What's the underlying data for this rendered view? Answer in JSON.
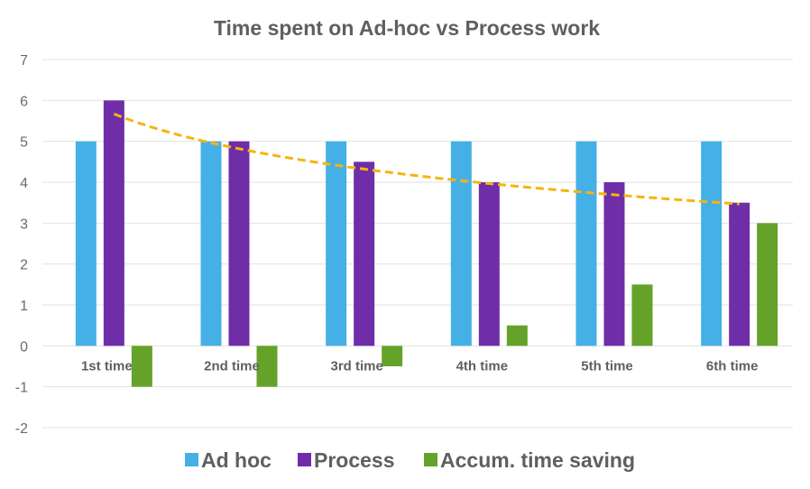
{
  "chart_data": {
    "type": "bar",
    "title": "Time spent on Ad-hoc vs Process work",
    "xlabel": "",
    "ylabel": "",
    "categories": [
      "1st time",
      "2nd time",
      "3rd time",
      "4th time",
      "5th time",
      "6th time"
    ],
    "series": [
      {
        "name": "Ad hoc",
        "color": "#45b0e5",
        "values": [
          5,
          5,
          5,
          5,
          5,
          5
        ]
      },
      {
        "name": "Process",
        "color": "#6f2da8",
        "values": [
          6,
          5,
          4.5,
          4,
          4,
          3.5
        ]
      },
      {
        "name": "Accum. time saving",
        "color": "#65a22a",
        "values": [
          -1,
          -1,
          -0.5,
          0.5,
          1.5,
          3
        ]
      }
    ],
    "trendline": {
      "series": "Process",
      "kind": "logarithmic",
      "style": "dashed",
      "color": "#f5b50e",
      "start_value": 5.67,
      "end_value": 3.47
    },
    "ylim": [
      -2,
      7
    ],
    "yticks": [
      "7",
      "6",
      "5",
      "4",
      "3",
      "2",
      "1",
      "0",
      "-1",
      "-2"
    ],
    "grid": true,
    "legend": "bottom"
  }
}
